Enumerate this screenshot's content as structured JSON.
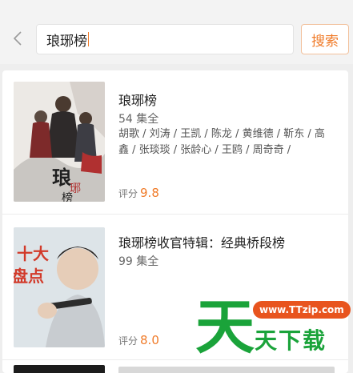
{
  "search": {
    "value": "琅琊榜",
    "button_label": "搜索"
  },
  "results": [
    {
      "title": "琅琊榜",
      "episodes": "54 集全",
      "cast": "胡歌 / 刘涛 / 王凯 / 陈龙 / 黄维德 / 靳东 / 高鑫 / 张琰琰 / 张龄心 / 王鸥 / 周奇奇 /",
      "rating_label": "评分",
      "rating_value": "9.8",
      "poster_text": "琅琊榜"
    },
    {
      "title": "琅琊榜收官特辑：经典桥段榜",
      "episodes": "99 集全",
      "rating_label": "评分",
      "rating_value": "8.0",
      "poster_text": "十大盘点"
    }
  ],
  "watermark": {
    "big_char": "天",
    "url": "www.TTzip.com",
    "text": "天下载"
  },
  "colors": {
    "accent": "#f07b29",
    "watermark_green": "#1aa33a",
    "watermark_orange": "#e8541e"
  },
  "icons": {
    "back": "chevron-left-icon"
  }
}
